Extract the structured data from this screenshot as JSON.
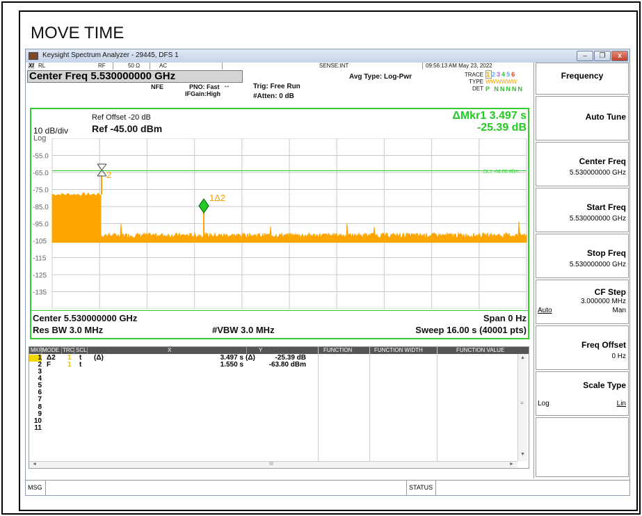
{
  "slide_title": "MOVE TIME",
  "window": {
    "title": "Keysight Spectrum Analyzer - 29445, DFS 1",
    "min_label": "‒",
    "restore_label": "❐",
    "close_label": "x"
  },
  "status_row": {
    "badge": "XI",
    "rl": "RL",
    "rf": "RF",
    "impedance": "50 Ω",
    "coupling": "AC",
    "sense": "SENSE:INT",
    "datetime": "09:56:13 AM May 23, 2022"
  },
  "header": {
    "center_freq": "Center Freq 5.530000000 GHz",
    "nfe": "NFE",
    "pno": "PNO: Fast",
    "ifgain": "IFGain:High",
    "trig": "Trig: Free Run",
    "atten": "#Atten: 0 dB",
    "avg_type": "Avg Type: Log-Pwr",
    "trace_label": "TRACE",
    "trace_values": [
      "1",
      "2",
      "3",
      "4",
      "5",
      "6"
    ],
    "type_label": "TYPE",
    "type_values": "WWWWWW",
    "det_label": "DET",
    "det_values": "P NNNNN"
  },
  "plot": {
    "ref_offset": "Ref Offset -20 dB",
    "ref_level": "Ref -45.00 dBm",
    "scale": "10 dB/div",
    "scale_type": "Log",
    "marker_readout_1": "ΔMkr1 3.497 s",
    "marker_readout_2": "-25.39 dB",
    "display_line": "DL1 -64.00 dBm",
    "y_ticks": [
      "-55.0",
      "-65.0",
      "-75.0",
      "-85.0",
      "-95.0",
      "-105",
      "-115",
      "-125",
      "-135"
    ],
    "marker2_label": "2",
    "marker1_label": "1Δ2",
    "colors": {
      "trace": "#ffa500",
      "grid": "#c8c8c8",
      "frame": "#33cc33",
      "display_line": "#33cc33"
    }
  },
  "bandwidth": {
    "center": "Center 5.530000000 GHz",
    "span": "Span 0 Hz",
    "res_bw": "Res BW 3.0 MHz",
    "vbw": "#VBW 3.0 MHz",
    "sweep": "Sweep  16.00 s (40001 pts)"
  },
  "marker_table": {
    "headers": [
      "MKR",
      "MODE",
      "TRC",
      "SCL",
      "X",
      "Y",
      "FUNCTION",
      "FUNCTION WIDTH",
      "FUNCTION VALUE"
    ],
    "rows": [
      {
        "mkr": "1",
        "mode": "Δ2",
        "trc": "1",
        "scl": "t",
        "xdelta": "(Δ)",
        "x": "3.497 s",
        "ydelta": "(Δ)",
        "y": "-25.39 dB"
      },
      {
        "mkr": "2",
        "mode": "F",
        "trc": "1",
        "scl": "t",
        "xdelta": "",
        "x": "1.550 s",
        "ydelta": "",
        "y": "-63.80 dBm"
      }
    ],
    "empty_rows": [
      "3",
      "4",
      "5",
      "6",
      "7",
      "8",
      "9",
      "10",
      "11"
    ],
    "scroll_mid": "III"
  },
  "msg_bar": {
    "msg": "MSG",
    "status": "STATUS"
  },
  "softkeys": {
    "title": "Frequency",
    "auto_tune": "Auto Tune",
    "center_freq": "Center Freq",
    "center_freq_val": "5.530000000 GHz",
    "start_freq": "Start Freq",
    "start_freq_val": "5.530000000 GHz",
    "stop_freq": "Stop Freq",
    "stop_freq_val": "5.530000000 GHz",
    "cf_step": "CF Step",
    "cf_step_val": "3.000000 MHz",
    "cf_auto": "Auto",
    "cf_man": "Man",
    "freq_offset": "Freq Offset",
    "freq_offset_val": "0 Hz",
    "scale_type": "Scale Type",
    "scale_log": "Log",
    "scale_lin": "Lin"
  }
}
